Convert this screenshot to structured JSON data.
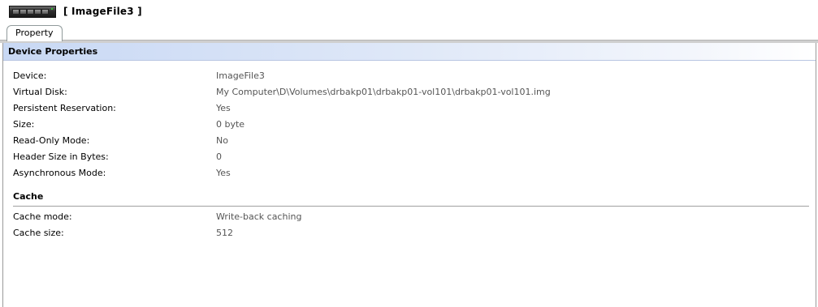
{
  "header": {
    "title": "[ ImageFile3 ]"
  },
  "tabs": [
    {
      "label": "Property"
    }
  ],
  "panel": {
    "title": "Device Properties",
    "properties": [
      {
        "label": "Device:",
        "value": "ImageFile3"
      },
      {
        "label": "Virtual Disk:",
        "value": "My Computer\\D\\Volumes\\drbakp01\\drbakp01-vol101\\drbakp01-vol101.img"
      },
      {
        "label": "Persistent Reservation:",
        "value": "Yes"
      },
      {
        "label": "Size:",
        "value": "0 byte"
      },
      {
        "label": "Read-Only Mode:",
        "value": "No"
      },
      {
        "label": "Header Size in Bytes:",
        "value": "0"
      },
      {
        "label": "Asynchronous Mode:",
        "value": "Yes"
      }
    ],
    "cache": {
      "title": "Cache",
      "properties": [
        {
          "label": "Cache mode:",
          "value": "Write-back caching"
        },
        {
          "label": "Cache size:",
          "value": "512"
        }
      ]
    }
  },
  "colors": {
    "header_gradient_start": "#c8d8f4",
    "value_text": "#555555"
  }
}
